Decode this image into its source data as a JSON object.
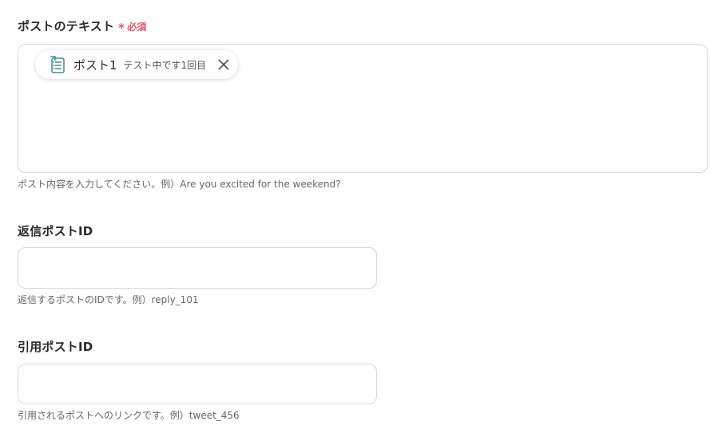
{
  "post_text": {
    "label": "ポストのテキスト",
    "required_star": "*",
    "required_text": "必須",
    "chip": {
      "icon": "list-document-icon",
      "label": "ポスト1",
      "value": "テスト中です1回目",
      "close_icon": "close-icon"
    },
    "help": "ポスト内容を入力してください。例）Are you excited for the weekend?"
  },
  "reply_post_id": {
    "label": "返信ポストID",
    "value": "",
    "help": "返信するポストのIDです。例）reply_101"
  },
  "quote_post_id": {
    "label": "引用ポストID",
    "value": "",
    "help": "引用されるポストへのリンクです。例）tweet_456"
  },
  "colors": {
    "required": "#e4566b",
    "border": "#d8d8d8",
    "icon_accent": "#3d8f96"
  }
}
